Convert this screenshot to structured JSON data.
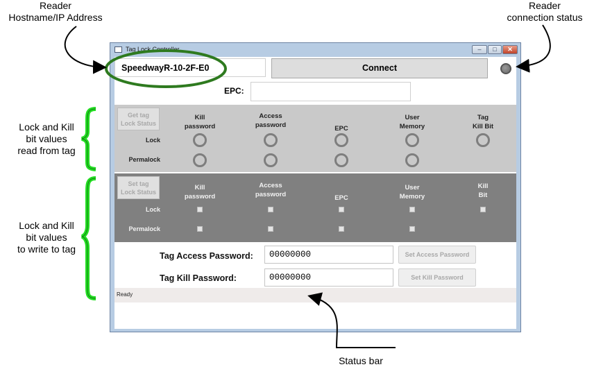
{
  "annotations": {
    "hostname": [
      "Reader",
      "Hostname/IP Address"
    ],
    "connection": [
      "Reader",
      "connection status"
    ],
    "read_values": [
      "Lock and Kill",
      "bit  values",
      "read from tag"
    ],
    "write_values": [
      "Lock and Kill",
      "bit  values",
      "to write to tag"
    ],
    "status_bar": "Status bar"
  },
  "window": {
    "title": "Tag Lock Controller",
    "minimize": "–",
    "maximize": "□",
    "close": "✕"
  },
  "reader": {
    "hostname": "SpeedwayR-10-2F-E0",
    "connect_label": "Connect"
  },
  "epc": {
    "label": "EPC:",
    "value": ""
  },
  "read_panel": {
    "button": [
      "Get tag",
      "Lock Status"
    ],
    "headers": [
      [
        "Kill",
        "password"
      ],
      [
        "Access",
        "password"
      ],
      [
        "",
        "EPC"
      ],
      [
        "User",
        "Memory"
      ],
      [
        "Tag",
        "Kill Bit"
      ]
    ],
    "rows": [
      "Lock",
      "Permalock"
    ]
  },
  "write_panel": {
    "button": [
      "Set tag",
      "Lock Status"
    ],
    "headers": [
      [
        "Kill",
        "password"
      ],
      [
        "Access",
        "password"
      ],
      [
        "",
        "EPC"
      ],
      [
        "User",
        "Memory"
      ],
      [
        "Kill",
        "Bit"
      ]
    ],
    "rows": [
      "Lock",
      "Permalock"
    ]
  },
  "access_password": {
    "label": "Tag Access Password:",
    "value": "00000000",
    "button": "Set Access Password"
  },
  "kill_password": {
    "label": "Tag Kill Password:",
    "value": "00000000",
    "button": "Set Kill Password"
  },
  "status": {
    "text": "Ready"
  },
  "colors": {
    "highlight_green": "#2e7a1f",
    "bracket_green": "#22dd22",
    "read_panel": "#c9c9c9",
    "write_panel": "#808080"
  }
}
